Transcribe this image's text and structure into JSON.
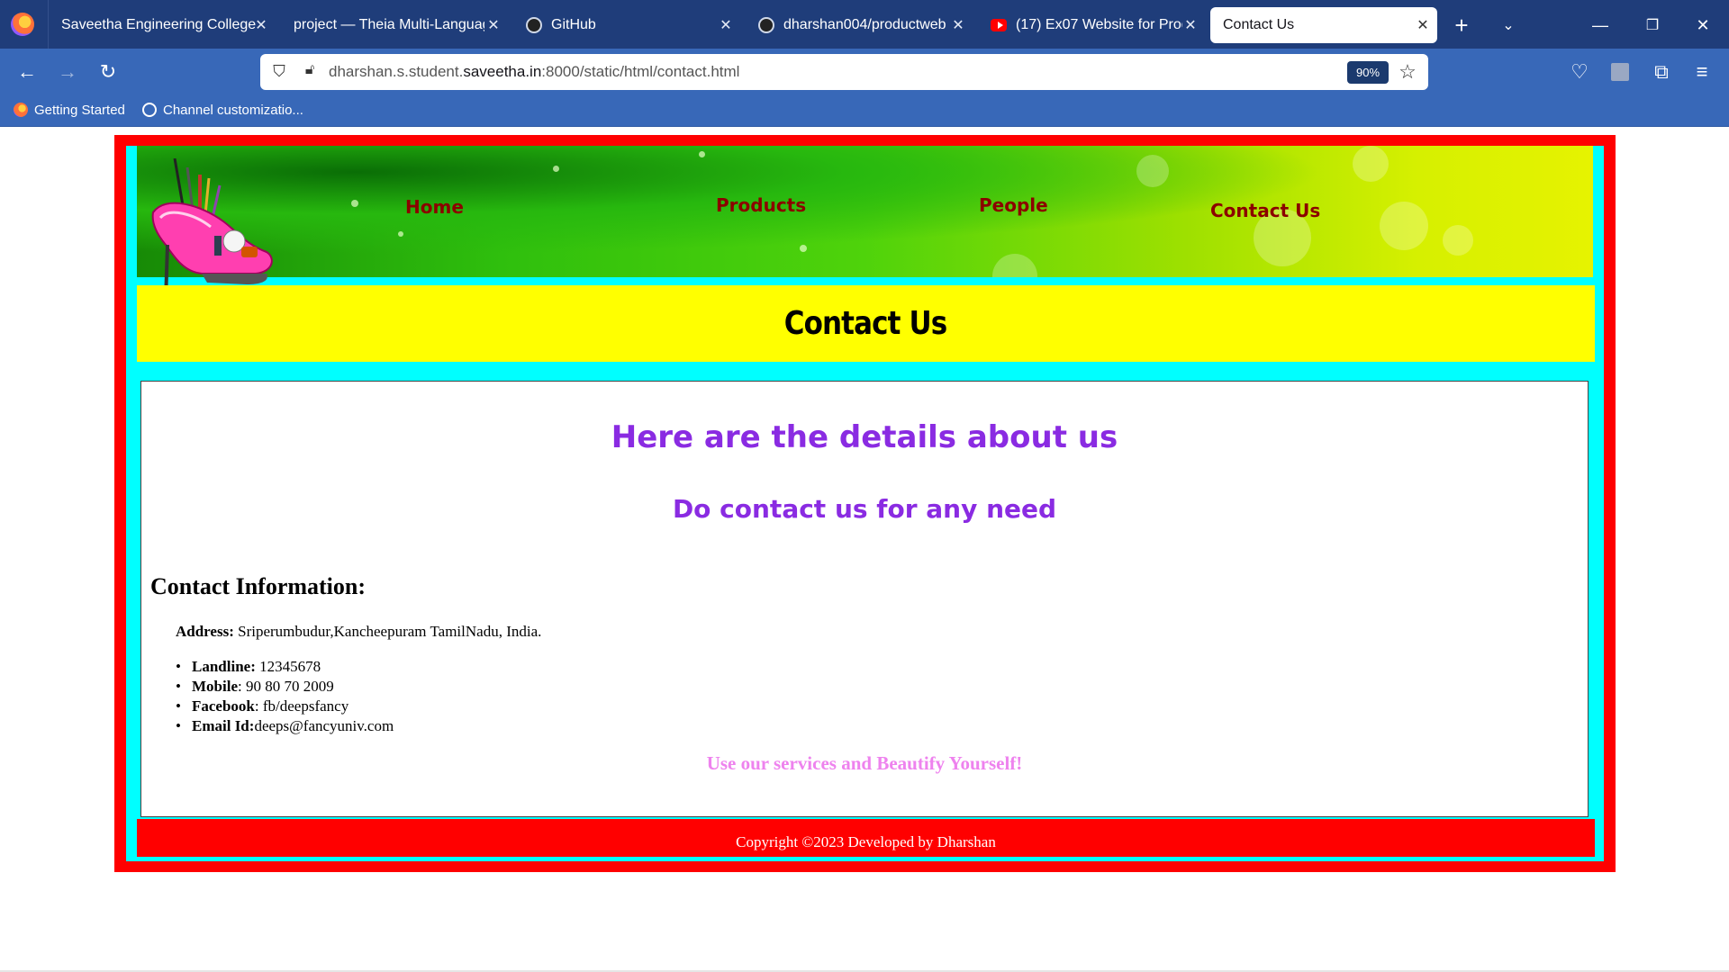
{
  "browser": {
    "tabs": [
      {
        "title": "Saveetha Engineering College",
        "icon": "none",
        "active": false
      },
      {
        "title": "project — Theia Multi-Language",
        "icon": "none",
        "active": false
      },
      {
        "title": "GitHub",
        "icon": "github-icon",
        "active": false
      },
      {
        "title": "dharshan004/productweb",
        "icon": "github-icon",
        "active": false
      },
      {
        "title": "(17) Ex07 Website for Produ",
        "icon": "youtube-icon",
        "active": false
      },
      {
        "title": "Contact Us",
        "icon": "none",
        "active": true
      }
    ],
    "url_prefix": "dharshan.s.student.",
    "url_domain": "saveetha.in",
    "url_suffix": ":8000/static/html/contact.html",
    "zoom": "90%",
    "bookmarks": [
      {
        "label": "Getting Started",
        "icon": "firefox-icon"
      },
      {
        "label": "Channel customizatio...",
        "icon": "globe-icon"
      }
    ]
  },
  "site": {
    "nav": [
      "Home",
      "Products",
      "People",
      "Contact Us"
    ],
    "title": "Contact Us",
    "heading_details": "Here are the details about us",
    "heading_contact": "Do contact us for any need",
    "info_title": "Contact Information:",
    "address_label": "Address:",
    "address_value": " Sriperumbudur,Kancheepuram TamilNadu, India.",
    "contacts": [
      {
        "label": "Landline:",
        "value": " 12345678"
      },
      {
        "label": "Mobile",
        "value": ": 90 80 70 2009"
      },
      {
        "label": "Facebook",
        "value": ": fb/deepsfancy"
      },
      {
        "label": "Email Id:",
        "value": "deeps@fancyuniv.com"
      }
    ],
    "tagline": "Use our services and Beautify Yourself!",
    "footer": "Copyright ©2023 Developed by Dharshan"
  },
  "colors": {
    "outer_border": "#ff0000",
    "inner_frame": "#00ffff",
    "title_band": "#ffff00",
    "nav_link": "#8b0000",
    "heading": "#8a2be2",
    "tagline": "#ee82ee",
    "footer": "#ff0000"
  }
}
